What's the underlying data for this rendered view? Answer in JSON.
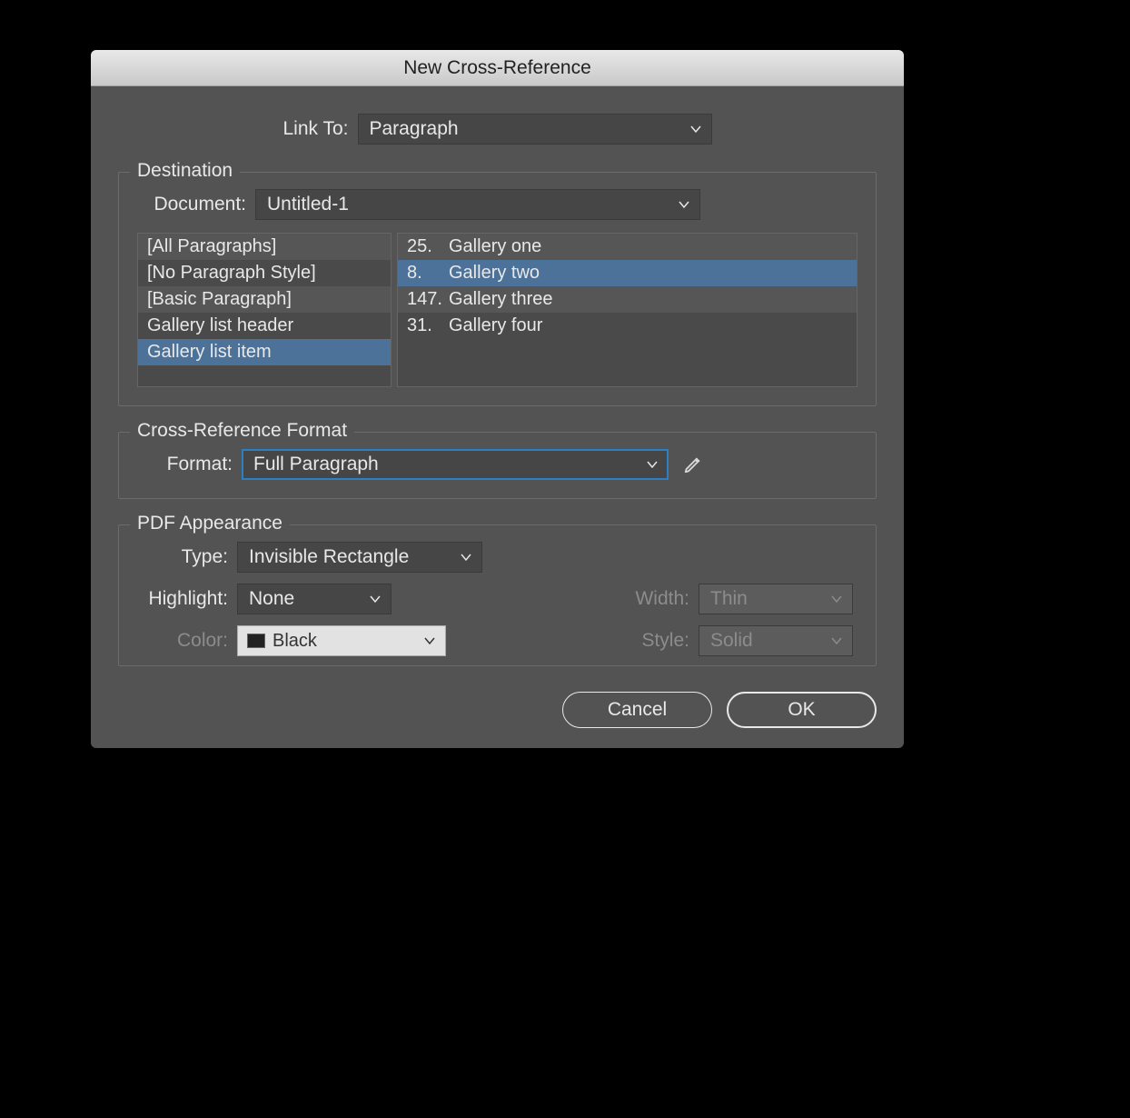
{
  "dialog": {
    "title": "New Cross-Reference",
    "linkto_label": "Link To:",
    "linkto_value": "Paragraph"
  },
  "destination": {
    "legend": "Destination",
    "document_label": "Document:",
    "document_value": "Untitled-1",
    "styles": [
      {
        "label": "[All Paragraphs]",
        "selected": false
      },
      {
        "label": "[No Paragraph Style]",
        "selected": false
      },
      {
        "label": "[Basic Paragraph]",
        "selected": false
      },
      {
        "label": "Gallery list header",
        "selected": false
      },
      {
        "label": "Gallery list item",
        "selected": true
      }
    ],
    "paragraphs": [
      {
        "num": "25.",
        "label": "Gallery one",
        "selected": false
      },
      {
        "num": "8.",
        "label": "Gallery two",
        "selected": true
      },
      {
        "num": "147.",
        "label": "Gallery three",
        "selected": false
      },
      {
        "num": "31.",
        "label": "Gallery four",
        "selected": false
      }
    ]
  },
  "format_section": {
    "legend": "Cross-Reference Format",
    "format_label": "Format:",
    "format_value": "Full Paragraph"
  },
  "pdf": {
    "legend": "PDF Appearance",
    "type_label": "Type:",
    "type_value": "Invisible Rectangle",
    "highlight_label": "Highlight:",
    "highlight_value": "None",
    "color_label": "Color:",
    "color_value": "Black",
    "width_label": "Width:",
    "width_value": "Thin",
    "style_label": "Style:",
    "style_value": "Solid"
  },
  "buttons": {
    "cancel": "Cancel",
    "ok": "OK"
  }
}
